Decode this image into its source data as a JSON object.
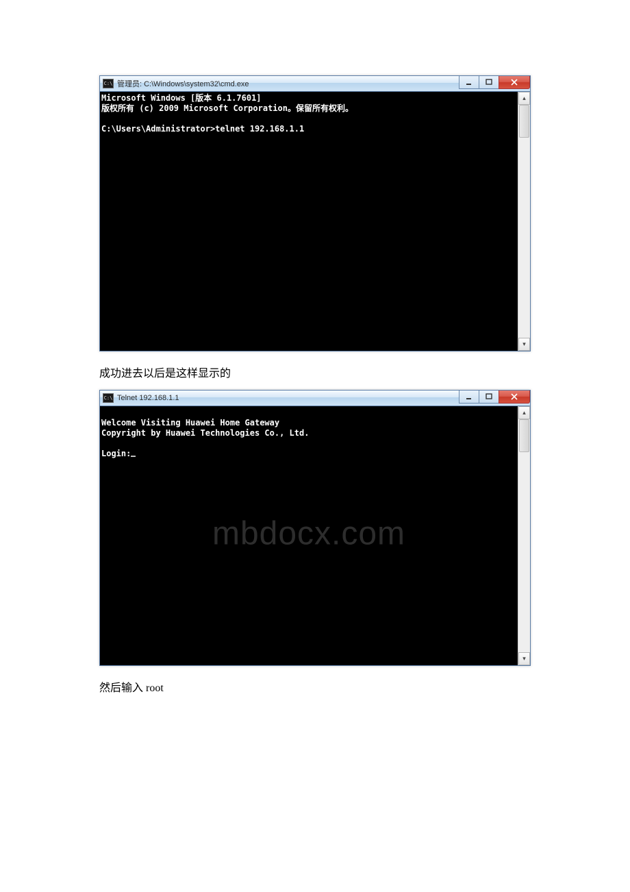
{
  "watermark": "mbdocx.com",
  "window1": {
    "icon_text": "C:\\",
    "title": "管理员: C:\\Windows\\system32\\cmd.exe",
    "lines": {
      "l1": "Microsoft Windows [版本 6.1.7601]",
      "l2": "版权所有 (c) 2009 Microsoft Corporation。保留所有权利。",
      "l3": "",
      "l4": "C:\\Users\\Administrator>telnet 192.168.1.1"
    }
  },
  "caption1": "成功进去以后是这样显示的",
  "window2": {
    "icon_text": "C:\\",
    "title": "Telnet 192.168.1.1",
    "lines": {
      "l1": "",
      "l2": "Welcome Visiting Huawei Home Gateway",
      "l3": "Copyright by Huawei Technologies Co., Ltd.",
      "l4": "",
      "l5": "Login:"
    }
  },
  "caption2": "然后输入 root"
}
